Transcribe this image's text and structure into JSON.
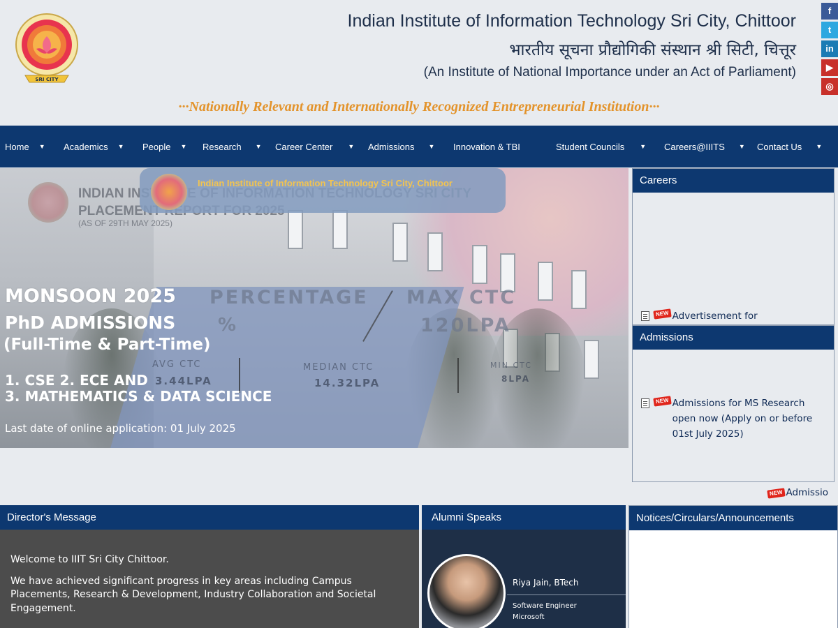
{
  "header": {
    "title_en": "Indian Institute of Information Technology Sri City, Chittoor",
    "title_hi": "भारतीय सूचना प्रौद्योगिकी संस्थान श्री सिटी, चित्तूर",
    "subtitle": "(An Institute of National Importance under an Act of Parliament)",
    "tagline": "···Nationally Relevant and Internationally Recognized Entrepreneurial Institution···",
    "logo_text": "SRI CITY"
  },
  "social": [
    {
      "icon": "facebook-icon",
      "glyph": "f",
      "color": "#3a5a98"
    },
    {
      "icon": "twitter-icon",
      "glyph": "t",
      "color": "#2da8e0"
    },
    {
      "icon": "linkedin-icon",
      "glyph": "in",
      "color": "#1a7bb4"
    },
    {
      "icon": "youtube-icon",
      "glyph": "▶",
      "color": "#c8302a"
    },
    {
      "icon": "instagram-icon",
      "glyph": "◎",
      "color": "#c8302a"
    }
  ],
  "nav": {
    "items": [
      {
        "label": "Home"
      },
      {
        "label": "Academics"
      },
      {
        "label": "People"
      },
      {
        "label": "Research"
      },
      {
        "label": "Career Center"
      },
      {
        "label": "Admissions"
      },
      {
        "label": "Innovation & TBI"
      },
      {
        "label": "Student Councils"
      },
      {
        "label": "Careers@IIITS"
      },
      {
        "label": "Contact Us"
      }
    ],
    "caret": "▼"
  },
  "hero": {
    "badge_text": "Indian Institute of Information Technology Sri City, Chittoor",
    "ghost_title_1": "INDIAN INSTITUTE OF INFORMATION TECHNOLOGY SRI CITY",
    "ghost_title_2": "PLACEMENT REPORT FOR 2025",
    "ghost_sub": "(AS OF 29TH MAY 2025)",
    "ghost_percentage": "PERCENTAGE",
    "ghost_max_ctc": "MAX CTC",
    "ghost_pct_val": "%",
    "ghost_max_val": "120LPA",
    "ghost_avg_label": "AVG CTC",
    "ghost_avg_val": "3.44LPA",
    "ghost_median_label": "MEDIAN CTC",
    "ghost_median_val": "14.32LPA",
    "ghost_min_label": "MIN CTC",
    "ghost_min_val": "8LPA",
    "title": "MONSOON 2025",
    "subtitle": "PhD ADMISSIONS",
    "mode": "(Full-Time & Part-Time)",
    "line1": "1. CSE  2. ECE  AND",
    "line2": "3. MATHEMATICS & DATA SCIENCE",
    "date": "Last date of online application: 01 July 2025"
  },
  "careers": {
    "title": "Careers",
    "items": [
      {
        "badge": "NEW",
        "text": "Advertisement for"
      }
    ]
  },
  "admissions": {
    "title": "Admissions",
    "items": [
      {
        "badge": "NEW",
        "text": "Admissions for MS Research open now (Apply on or before 01st July 2025)"
      }
    ]
  },
  "ticker": {
    "badge": "NEW",
    "text": "Admissio"
  },
  "director": {
    "title": "Director's Message",
    "p1": "Welcome to IIIT Sri City Chittoor.",
    "p2": "We have achieved significant progress in key areas including Campus Placements, Research & Development, Industry Collaboration and Societal Engagement."
  },
  "alumni": {
    "title": "Alumni Speaks",
    "name": "Riya Jain, BTech",
    "role": "Software Engineer",
    "org": "Microsoft"
  },
  "notices": {
    "title": "Notices/Circulars/Announcements"
  }
}
